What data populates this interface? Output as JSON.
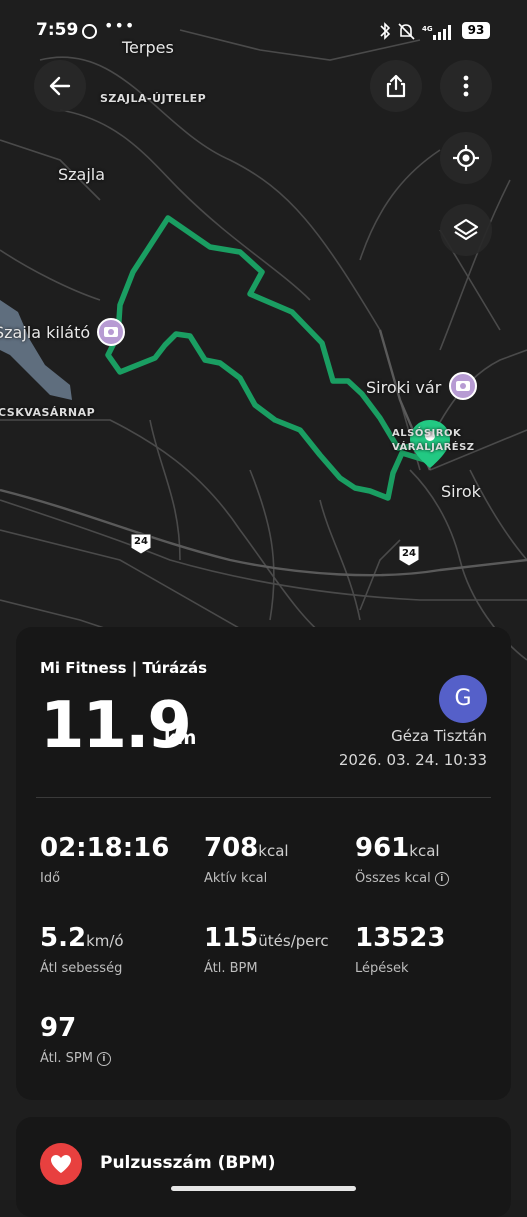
{
  "status_bar": {
    "time": "7:59",
    "battery": "93"
  },
  "map": {
    "labels": {
      "terpes": "Terpes",
      "szajla_ujtelep": "SZAJLA-ÚJTELEP",
      "szajla": "Szajla",
      "szajla_kilato": "Szajla kilátó",
      "csutortok": "CSKVASÁRNAP",
      "siroki_var": "Siroki vár",
      "also_sirok_1": "ALSÓSIROK",
      "also_sirok_2": "VÁRALJARÉSZ",
      "sirok": "Sirok",
      "road_24a": "24",
      "road_24b": "24"
    },
    "route_color": "#1a9e62",
    "marker_color": "#22c983",
    "poi_color": "#b79bd3"
  },
  "activity": {
    "source": "Mi Fitness | Túrázás",
    "distance_value": "11.9",
    "distance_unit": "km",
    "user_initial": "G",
    "user_name": "Géza Tisztán",
    "datetime": "2026. 03. 24. 10:33",
    "stats": [
      {
        "value": "02:18:16",
        "unit": "",
        "label": "Idő"
      },
      {
        "value": "708",
        "unit": "kcal",
        "label": "Aktív kcal"
      },
      {
        "value": "961",
        "unit": "kcal",
        "label": "Összes kcal"
      },
      {
        "value": "5.2",
        "unit": "km/ó",
        "label": "Átl sebesség"
      },
      {
        "value": "115",
        "unit": "ütés/perc",
        "label": "Átl. BPM"
      },
      {
        "value": "13523",
        "unit": "",
        "label": "Lépések"
      },
      {
        "value": "97",
        "unit": "",
        "label": "Átl. SPM"
      }
    ]
  },
  "heart_rate": {
    "title": "Pulzusszám (BPM)"
  },
  "colors": {
    "accent_avatar": "#5560c9",
    "heart": "#e8403f",
    "card_bg": "#171717"
  }
}
